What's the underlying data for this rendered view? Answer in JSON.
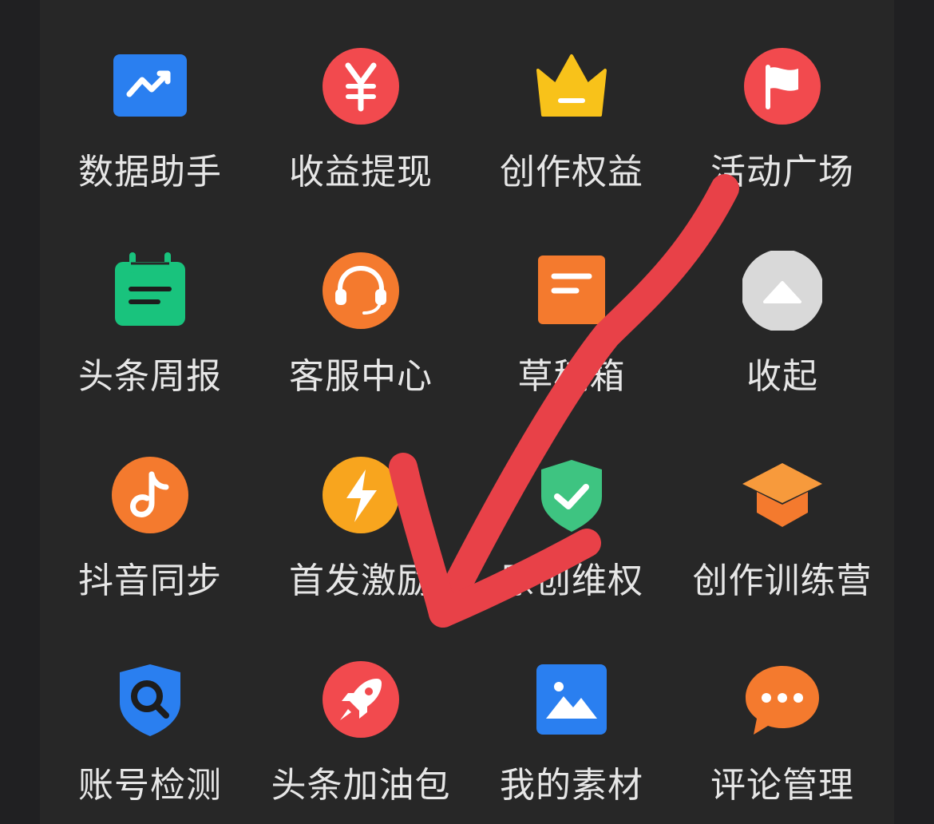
{
  "menu": {
    "items": [
      {
        "label": "数据助手",
        "icon": "trend-chart-icon"
      },
      {
        "label": "收益提现",
        "icon": "yen-icon"
      },
      {
        "label": "创作权益",
        "icon": "crown-icon"
      },
      {
        "label": "活动广场",
        "icon": "flag-icon"
      },
      {
        "label": "头条周报",
        "icon": "calendar-note-icon"
      },
      {
        "label": "客服中心",
        "icon": "headset-icon"
      },
      {
        "label": "草稿箱",
        "icon": "draft-icon"
      },
      {
        "label": "收起",
        "icon": "collapse-up-icon"
      },
      {
        "label": "抖音同步",
        "icon": "douyin-icon"
      },
      {
        "label": "首发激励",
        "icon": "lightning-icon"
      },
      {
        "label": "原创维权",
        "icon": "shield-check-icon"
      },
      {
        "label": "创作训练营",
        "icon": "graduation-cap-icon"
      },
      {
        "label": "账号检测",
        "icon": "shield-search-icon"
      },
      {
        "label": "头条加油包",
        "icon": "rocket-icon"
      },
      {
        "label": "我的素材",
        "icon": "image-icon"
      },
      {
        "label": "评论管理",
        "icon": "comment-icon"
      }
    ]
  },
  "colors": {
    "background": "#202022",
    "panel": "#272727",
    "label_text": "#e6e6e6",
    "annotation_arrow": "#e84148"
  }
}
